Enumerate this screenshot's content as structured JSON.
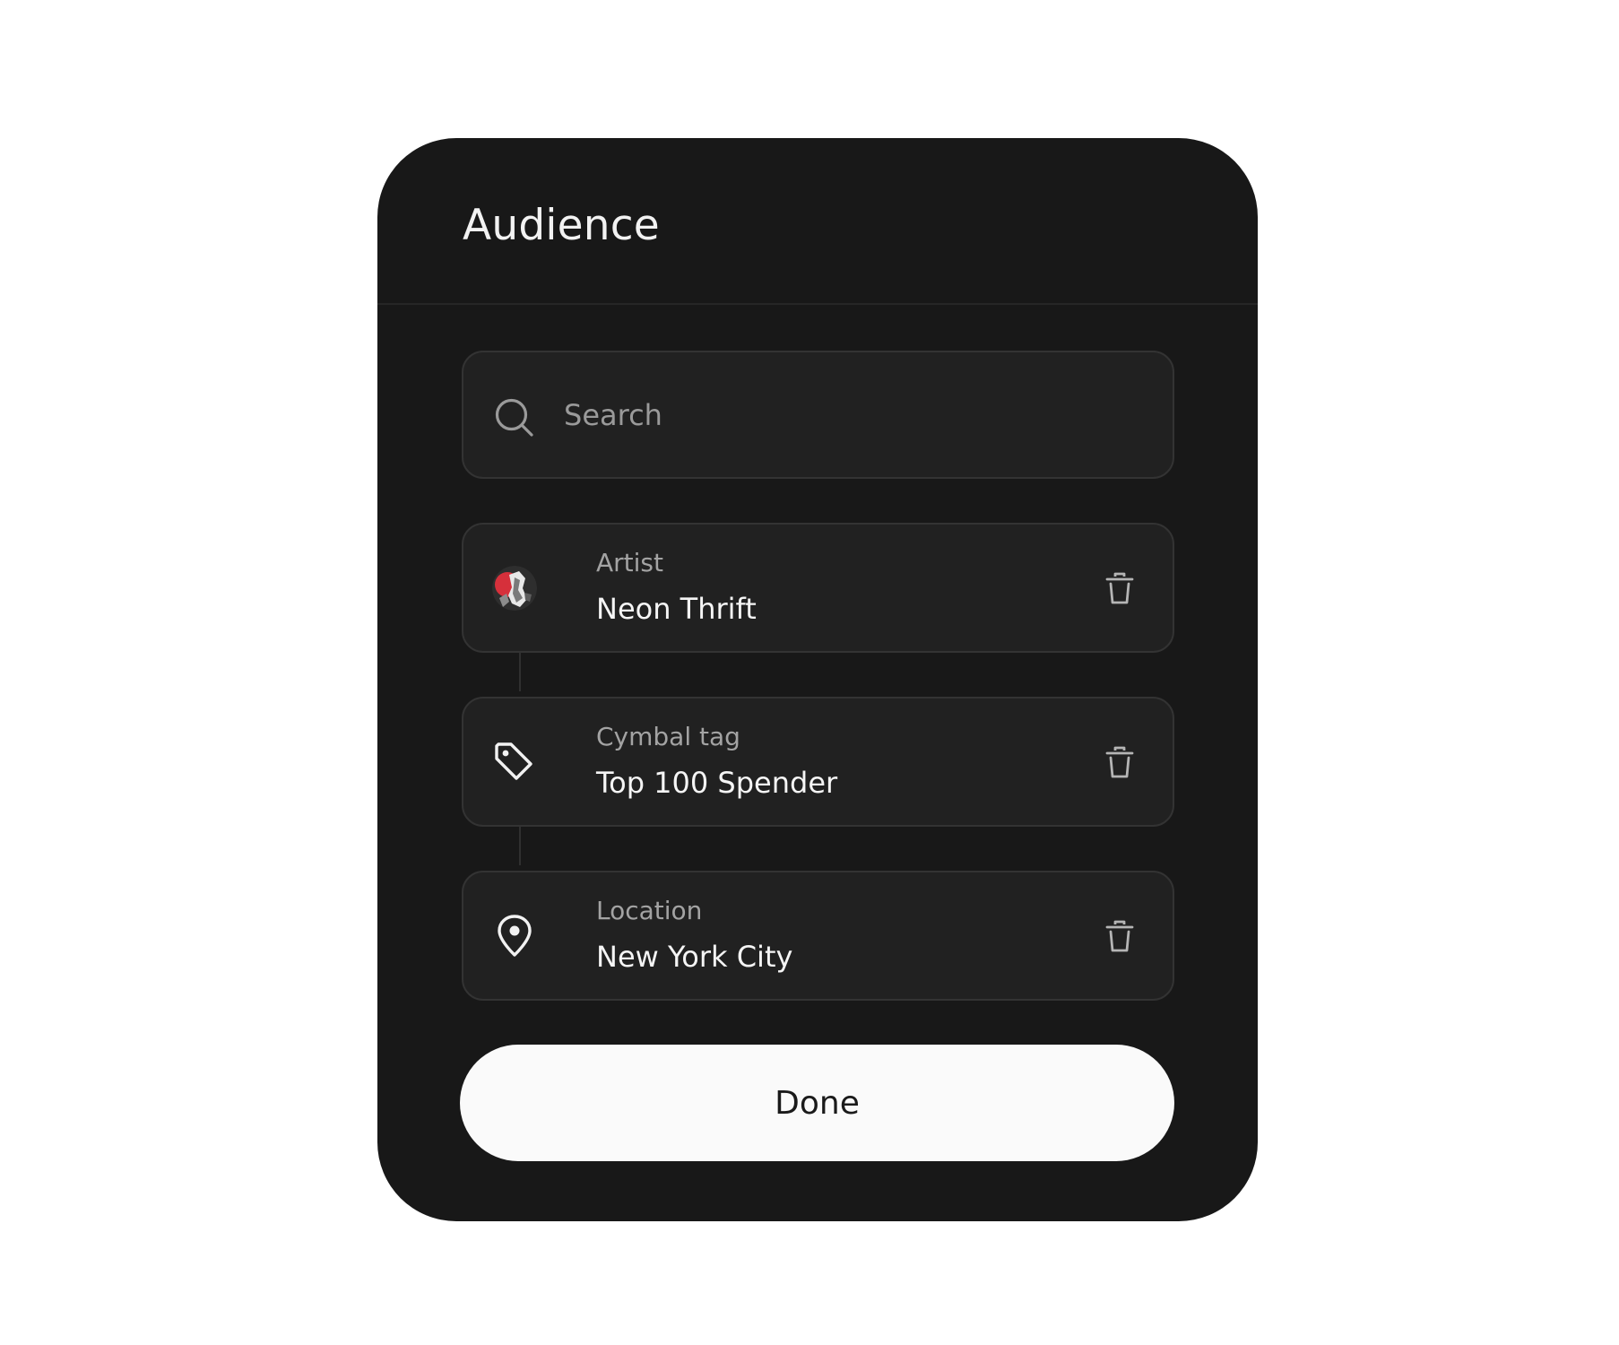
{
  "dialog": {
    "title": "Audience"
  },
  "search": {
    "placeholder": "Search",
    "value": ""
  },
  "items": [
    {
      "label": "Artist",
      "value": "Neon Thrift",
      "icon": "artist-avatar"
    },
    {
      "label": "Cymbal tag",
      "value": "Top 100 Spender",
      "icon": "tag-icon"
    },
    {
      "label": "Location",
      "value": "New York City",
      "icon": "map-pin-icon"
    }
  ],
  "actions": {
    "done_label": "Done"
  },
  "colors": {
    "dialog_background": "#181818",
    "card_background": "#212121",
    "card_border": "#333333",
    "button_background": "#fafafa",
    "avatar_accent": "#d6303b"
  }
}
